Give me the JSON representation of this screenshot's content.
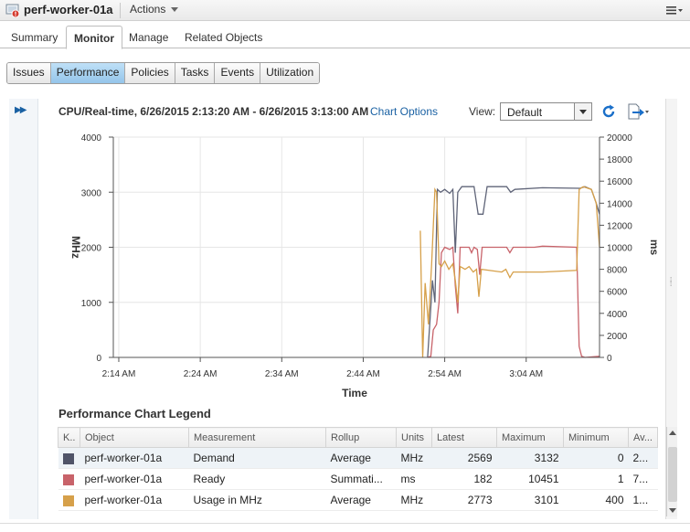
{
  "window": {
    "title": "perf-worker-01a",
    "actions_label": "Actions"
  },
  "main_tabs": [
    {
      "label": "Summary",
      "active": false
    },
    {
      "label": "Monitor",
      "active": true
    },
    {
      "label": "Manage",
      "active": false
    },
    {
      "label": "Related Objects",
      "active": false
    }
  ],
  "sub_tabs": [
    {
      "label": "Issues",
      "active": false
    },
    {
      "label": "Performance",
      "active": true
    },
    {
      "label": "Policies",
      "active": false
    },
    {
      "label": "Tasks",
      "active": false
    },
    {
      "label": "Events",
      "active": false
    },
    {
      "label": "Utilization",
      "active": false
    }
  ],
  "chart_header": {
    "title": "CPU/Real-time, 6/26/2015 2:13:20 AM - 6/26/2015 3:13:00 AM",
    "options_link": "Chart Options",
    "view_label": "View:",
    "view_value": "Default"
  },
  "chart_data": {
    "type": "line",
    "xlabel": "Time",
    "ylabel_left": "MHz",
    "ylabel_right": "ms",
    "x_ticks": [
      "2:14 AM",
      "2:24 AM",
      "2:34 AM",
      "2:44 AM",
      "2:54 AM",
      "3:04 AM"
    ],
    "y_left_ticks": [
      0,
      1000,
      2000,
      3000,
      4000
    ],
    "y_right_ticks": [
      0,
      2000,
      4000,
      6000,
      8000,
      10000,
      12000,
      14000,
      16000,
      18000,
      20000
    ],
    "ylim_left": [
      0,
      4000
    ],
    "ylim_right": [
      0,
      20000
    ],
    "xlim_minutes_after_2am": [
      13.33,
      73.0
    ],
    "grid": true,
    "series": [
      {
        "name": "Demand",
        "axis": "left",
        "color": "#5f6478",
        "points": [
          [
            51.9,
            0
          ],
          [
            52.2,
            700
          ],
          [
            52.5,
            1400
          ],
          [
            52.8,
            1000
          ],
          [
            53.1,
            3050
          ],
          [
            53.5,
            3000
          ],
          [
            54.0,
            3050
          ],
          [
            54.6,
            2980
          ],
          [
            55.0,
            3050
          ],
          [
            55.3,
            1900
          ],
          [
            55.6,
            3000
          ],
          [
            56.1,
            3100
          ],
          [
            57.6,
            3100
          ],
          [
            58.1,
            2600
          ],
          [
            58.7,
            2600
          ],
          [
            59.2,
            3100
          ],
          [
            61.6,
            3100
          ],
          [
            62.1,
            3000
          ],
          [
            62.6,
            3050
          ],
          [
            66.0,
            3080
          ],
          [
            70.6,
            3070
          ],
          [
            71.2,
            3100
          ],
          [
            72.0,
            3050
          ],
          [
            72.6,
            2800
          ],
          [
            73.0,
            2600
          ]
        ]
      },
      {
        "name": "Ready",
        "axis": "right",
        "color": "#c8636a",
        "points": [
          [
            51.9,
            0
          ],
          [
            52.3,
            100
          ],
          [
            52.6,
            2500
          ],
          [
            53.0,
            3000
          ],
          [
            53.3,
            5000
          ],
          [
            53.6,
            9500
          ],
          [
            54.0,
            10000
          ],
          [
            54.6,
            9800
          ],
          [
            55.0,
            10000
          ],
          [
            55.3,
            6500
          ],
          [
            55.6,
            4000
          ],
          [
            55.9,
            10000
          ],
          [
            57.0,
            10000
          ],
          [
            57.3,
            9500
          ],
          [
            57.6,
            10000
          ],
          [
            58.0,
            9800
          ],
          [
            58.3,
            7500
          ],
          [
            58.6,
            10000
          ],
          [
            61.6,
            10000
          ],
          [
            62.0,
            9500
          ],
          [
            62.4,
            10000
          ],
          [
            65.0,
            10000
          ],
          [
            66.0,
            10100
          ],
          [
            70.2,
            10000
          ],
          [
            70.5,
            1000
          ],
          [
            70.8,
            100
          ],
          [
            71.2,
            0
          ],
          [
            73.0,
            100
          ]
        ]
      },
      {
        "name": "Usage in MHz",
        "axis": "left",
        "color": "#d6a04a",
        "points": [
          [
            51.0,
            2300
          ],
          [
            51.3,
            0
          ],
          [
            51.6,
            1350
          ],
          [
            52.0,
            600
          ],
          [
            52.4,
            1700
          ],
          [
            52.8,
            3050
          ],
          [
            53.0,
            3000
          ],
          [
            53.3,
            1700
          ],
          [
            53.6,
            1650
          ],
          [
            54.0,
            1750
          ],
          [
            54.5,
            1600
          ],
          [
            55.0,
            1700
          ],
          [
            55.3,
            1400
          ],
          [
            55.6,
            1000
          ],
          [
            55.9,
            1650
          ],
          [
            56.5,
            1600
          ],
          [
            57.0,
            1650
          ],
          [
            57.5,
            1550
          ],
          [
            57.9,
            1600
          ],
          [
            58.2,
            1100
          ],
          [
            58.5,
            1600
          ],
          [
            61.0,
            1550
          ],
          [
            61.5,
            1600
          ],
          [
            62.0,
            1450
          ],
          [
            62.4,
            1550
          ],
          [
            66.0,
            1550
          ],
          [
            70.2,
            1580
          ],
          [
            70.5,
            3050
          ],
          [
            71.0,
            3100
          ],
          [
            72.0,
            3050
          ],
          [
            72.6,
            2800
          ],
          [
            73.0,
            2000
          ]
        ]
      }
    ]
  },
  "legend": {
    "title": "Performance Chart Legend",
    "columns": [
      "K..",
      "Object",
      "Measurement",
      "Rollup",
      "Units",
      "Latest",
      "Maximum",
      "Minimum",
      "Av..."
    ],
    "rows": [
      {
        "color": "#505468",
        "object": "perf-worker-01a",
        "measurement": "Demand",
        "rollup": "Average",
        "units": "MHz",
        "latest": "2569",
        "maximum": "3132",
        "minimum": "0",
        "average": "2..."
      },
      {
        "color": "#c8636a",
        "object": "perf-worker-01a",
        "measurement": "Ready",
        "rollup": "Summati...",
        "units": "ms",
        "latest": "182",
        "maximum": "10451",
        "minimum": "1",
        "average": "7..."
      },
      {
        "color": "#d6a04a",
        "object": "perf-worker-01a",
        "measurement": "Usage in MHz",
        "rollup": "Average",
        "units": "MHz",
        "latest": "2773",
        "maximum": "3101",
        "minimum": "400",
        "average": "1..."
      }
    ]
  },
  "icons": {
    "vm": "vm-alert-icon",
    "expand": "double-chevron-right-icon",
    "refresh": "refresh-icon",
    "export": "export-icon",
    "menu": "list-menu-icon"
  }
}
